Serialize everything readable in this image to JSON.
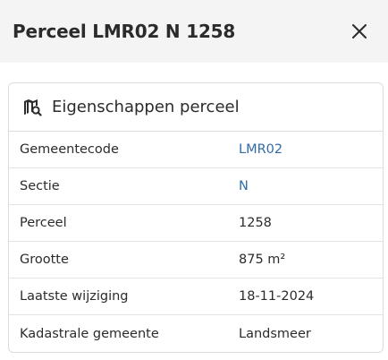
{
  "header": {
    "title": "Perceel LMR02 N 1258",
    "close_icon": "close-icon"
  },
  "card": {
    "icon": "map-search-icon",
    "title": "Eigenschappen perceel",
    "rows": [
      {
        "label": "Gemeentecode",
        "value": "LMR02",
        "link": true
      },
      {
        "label": "Sectie",
        "value": "N",
        "link": true
      },
      {
        "label": "Perceel",
        "value": "1258",
        "link": false
      },
      {
        "label": "Grootte",
        "value": "875 m²",
        "link": false
      },
      {
        "label": "Laatste wijziging",
        "value": "18-11-2024",
        "link": false
      },
      {
        "label": "Kadastrale gemeente",
        "value": "Landsmeer",
        "link": false
      }
    ]
  },
  "colors": {
    "link": "#2f6ba8",
    "text": "#2b2b2b",
    "header_bg": "#f4f4f4",
    "border": "#dcdcdc"
  }
}
